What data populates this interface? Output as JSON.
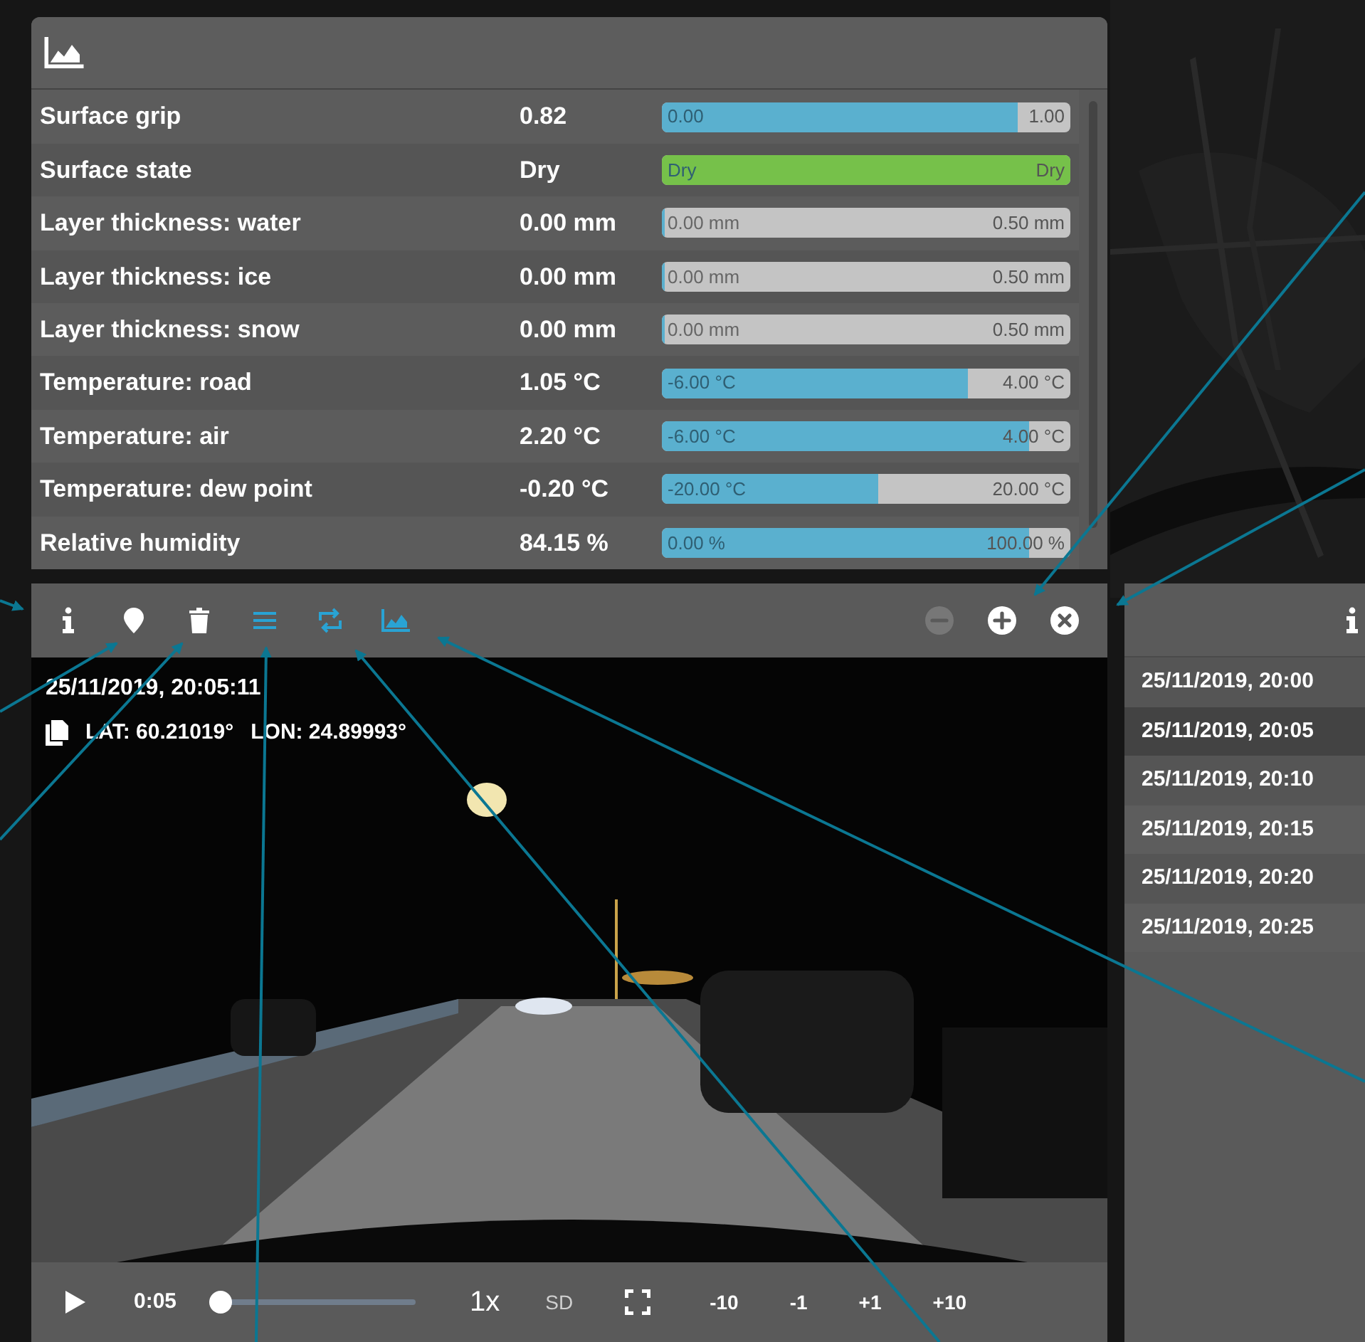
{
  "data_panel": {
    "rows": [
      {
        "label": "Surface grip",
        "value": "0.82",
        "bar": {
          "min": "0.00",
          "max": "1.00",
          "level": 0.87,
          "color": "#5ab0cf"
        }
      },
      {
        "label": "Surface state",
        "value": "Dry",
        "bar": {
          "min": "Dry",
          "max": "Dry",
          "level": 1,
          "color": "#76c14a"
        }
      },
      {
        "label": "Layer thickness: water",
        "value": "0.00 mm",
        "bar": {
          "min": "0.00 mm",
          "max": "0.50 mm",
          "level": 0,
          "color": "#5ab0cf"
        }
      },
      {
        "label": "Layer thickness: ice",
        "value": "0.00 mm",
        "bar": {
          "min": "0.00 mm",
          "max": "0.50 mm",
          "level": 0,
          "color": "#5ab0cf"
        }
      },
      {
        "label": "Layer thickness: snow",
        "value": "0.00 mm",
        "bar": {
          "min": "0.00 mm",
          "max": "0.50 mm",
          "level": 0,
          "color": "#5ab0cf"
        }
      },
      {
        "label": "Temperature: road",
        "value": "1.05 °C",
        "bar": {
          "min": "-6.00 °C",
          "max": "4.00 °C",
          "level": 0.75,
          "color": "#5ab0cf"
        }
      },
      {
        "label": "Temperature: air",
        "value": "2.20 °C",
        "bar": {
          "min": "-6.00 °C",
          "max": "4.00 °C",
          "level": 0.9,
          "color": "#5ab0cf"
        }
      },
      {
        "label": "Temperature: dew point",
        "value": "-0.20 °C",
        "bar": {
          "min": "-20.00 °C",
          "max": "20.00 °C",
          "level": 0.53,
          "color": "#5ab0cf"
        }
      },
      {
        "label": "Relative humidity",
        "value": "84.15 %",
        "bar": {
          "min": "0.00 %",
          "max": "100.00 %",
          "level": 0.9,
          "color": "#5ab0cf"
        }
      }
    ]
  },
  "video_panel": {
    "toolbar": [
      {
        "kind": "info",
        "active": false
      },
      {
        "kind": "marker",
        "active": false
      },
      {
        "kind": "trash",
        "active": false
      },
      {
        "kind": "list",
        "active": true
      },
      {
        "kind": "repeat",
        "active": true
      },
      {
        "kind": "chart",
        "active": true
      }
    ],
    "window_buttons": [
      {
        "kind": "minus",
        "disabled": true
      },
      {
        "kind": "plus",
        "disabled": false
      },
      {
        "kind": "close",
        "disabled": false
      }
    ],
    "timestamp": "25/11/2019, 20:05:11",
    "lat": "LAT: 60.21019°",
    "lon": "LON: 24.89993°",
    "controls": {
      "time": "0:05",
      "progress": {
        "level": 0.02
      },
      "speed": "1x",
      "quality": "SD",
      "skips": [
        "-10",
        "-1",
        "+1",
        "+10"
      ]
    }
  },
  "list_panel": {
    "items": [
      {
        "label": "25/11/2019, 20:00",
        "selected": false
      },
      {
        "label": "25/11/2019, 20:05",
        "selected": true
      },
      {
        "label": "25/11/2019, 20:10",
        "selected": false
      },
      {
        "label": "25/11/2019, 20:15",
        "selected": false
      },
      {
        "label": "25/11/2019, 20:20",
        "selected": false
      },
      {
        "label": "25/11/2019, 20:25",
        "selected": false
      }
    ]
  }
}
